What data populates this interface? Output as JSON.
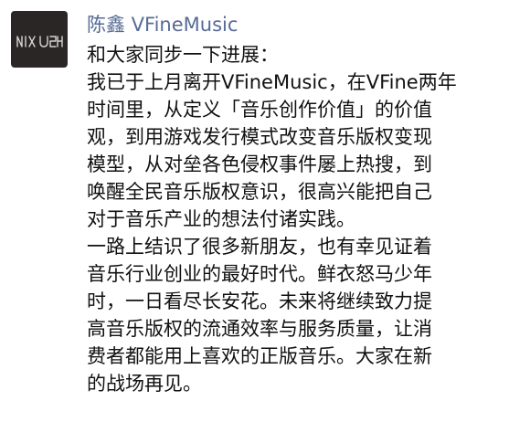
{
  "post": {
    "author": "陈鑫 VFineMusic",
    "avatar_icon": "scribble-avatar-icon",
    "lines": [
      "和大家同步一下进展：",
      "我已于上月离开VFineMusic，在VFine两年",
      "时间里，从定义「音乐创作价值」的价值",
      "观，到用游戏发行模式改变音乐版权变现",
      "模型，从对垒各色侵权事件屡上热搜，到",
      "唤醒全民音乐版权意识，很高兴能把自己",
      "对于音乐产业的想法付诸实践。",
      "一路上结识了很多新朋友，也有幸见证着",
      "音乐行业创业的最好时代。鲜衣怒马少年",
      "时，一日看尽长安花。未来将继续致力提",
      "高音乐版权的流通效率与服务质量，让消",
      "费者都能用上喜欢的正版音乐。大家在新",
      "的战场再见。"
    ]
  },
  "colors": {
    "author_link": "#576b95",
    "text": "#111111",
    "avatar_bg": "#2b2626",
    "avatar_ink": "#d8d4d2"
  }
}
